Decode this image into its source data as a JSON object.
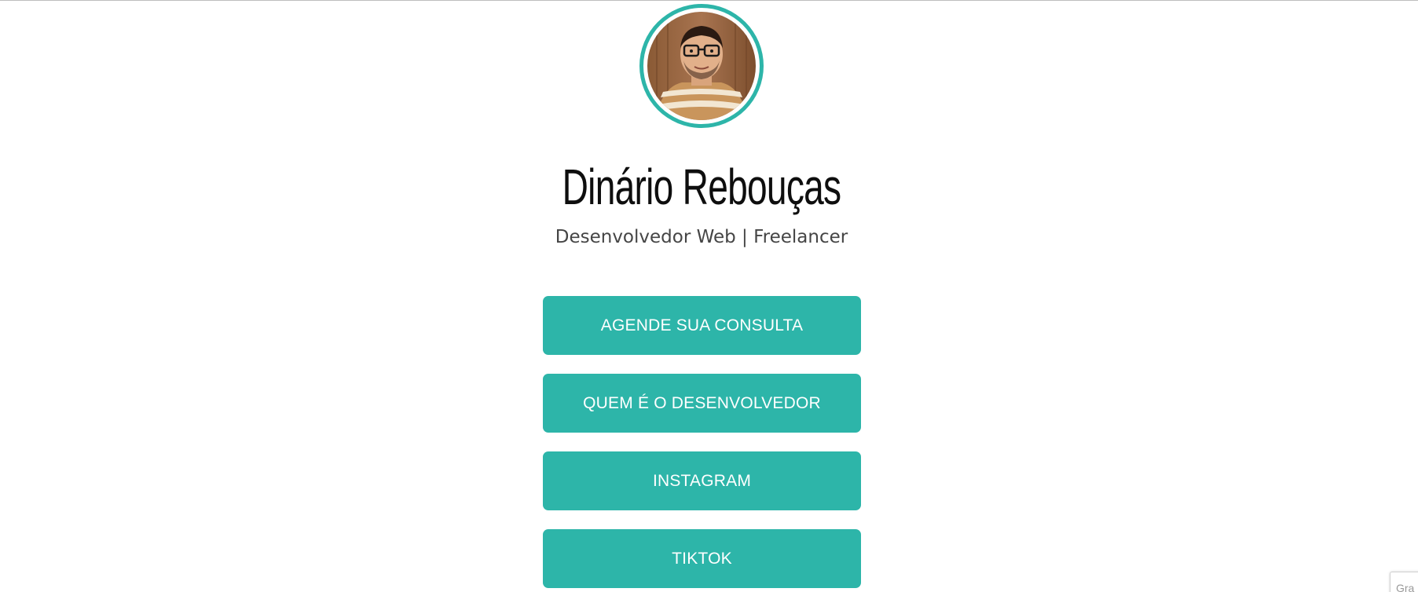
{
  "profile": {
    "name": "Dinário Rebouças",
    "subtitle": "Desenvolvedor Web | Freelancer",
    "avatar_icon": "profile-photo",
    "accent_color": "#2db5a9"
  },
  "links": [
    {
      "label": "AGENDE SUA CONSULTA"
    },
    {
      "label": "QUEM É O DESENVOLVEDOR"
    },
    {
      "label": "INSTAGRAM"
    },
    {
      "label": "TIKTOK"
    }
  ],
  "corner_badge": {
    "text": "Gra"
  }
}
